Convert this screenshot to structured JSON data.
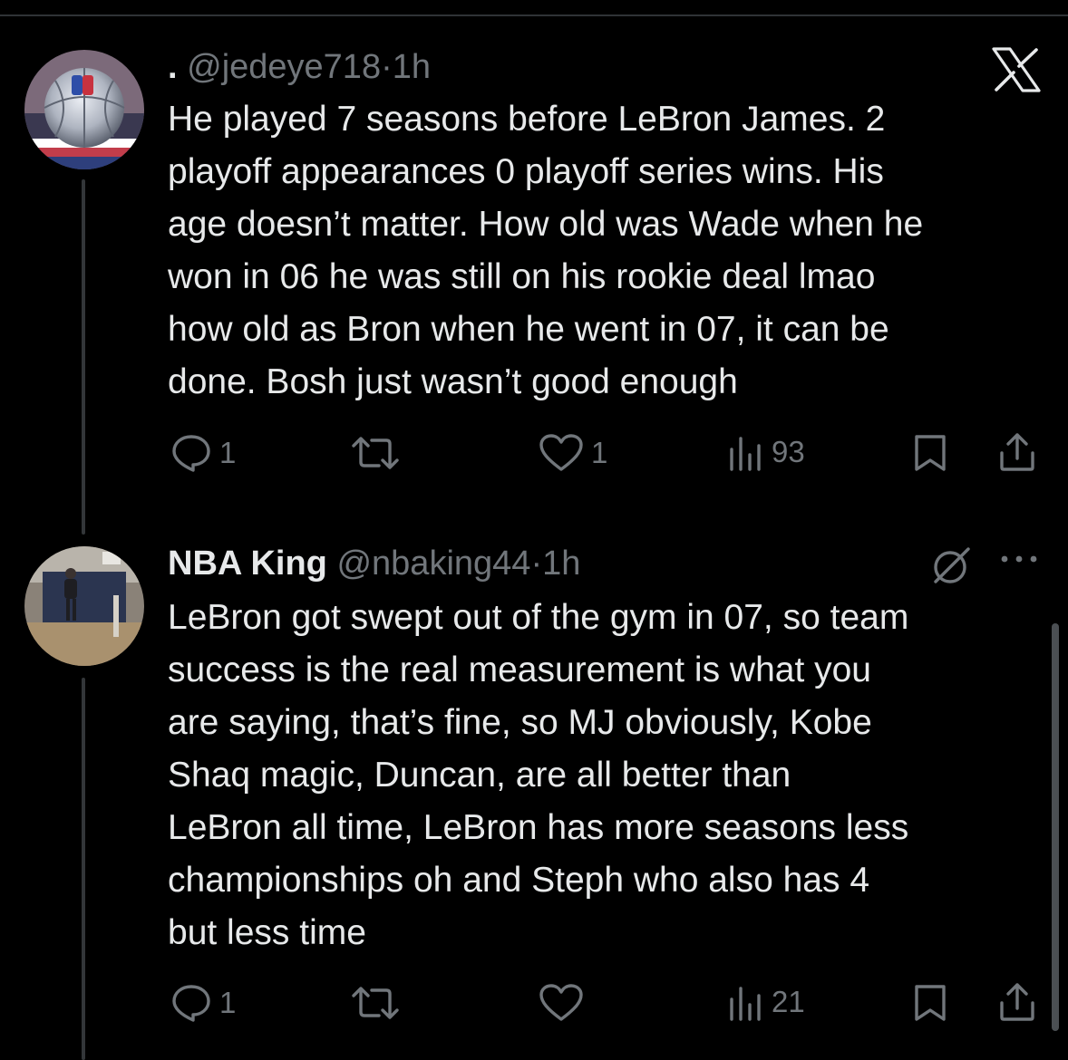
{
  "brand": {
    "x_logo_icon": "x-logo-icon"
  },
  "tweets": [
    {
      "display_name": ".",
      "handle": "@jedeye718",
      "separator": "·",
      "time": "1h",
      "text_lines": [
        "He played 7 seasons before LeBron James. 2",
        "playoff appearances 0 playoff series wins. His",
        "age doesn’t matter. How old was Wade when he",
        "won in 06 he was still on his rookie deal lmao",
        "how old as Bron when he went in 07, it can be",
        "done. Bosh just wasn’t good enough"
      ],
      "actions": {
        "replies": "1",
        "reposts": "",
        "likes": "1",
        "views": "93"
      }
    },
    {
      "display_name": "NBA King",
      "handle": "@nbaking44",
      "separator": "·",
      "time": "1h",
      "text_lines": [
        "LeBron got swept out of the gym in 07, so team",
        "success is the real measurement is what you",
        "are saying, that’s fine, so MJ obviously, Kobe",
        "Shaq magic, Duncan, are all better than",
        "LeBron all time, LeBron has more seasons less",
        "championships oh and Steph who also has 4",
        "but less time"
      ],
      "actions": {
        "replies": "1",
        "reposts": "",
        "likes": "",
        "views": "21"
      }
    }
  ],
  "colors": {
    "background": "#000000",
    "text_primary": "#e7e9ea",
    "text_secondary": "#71767b",
    "thread_line": "#333639"
  }
}
